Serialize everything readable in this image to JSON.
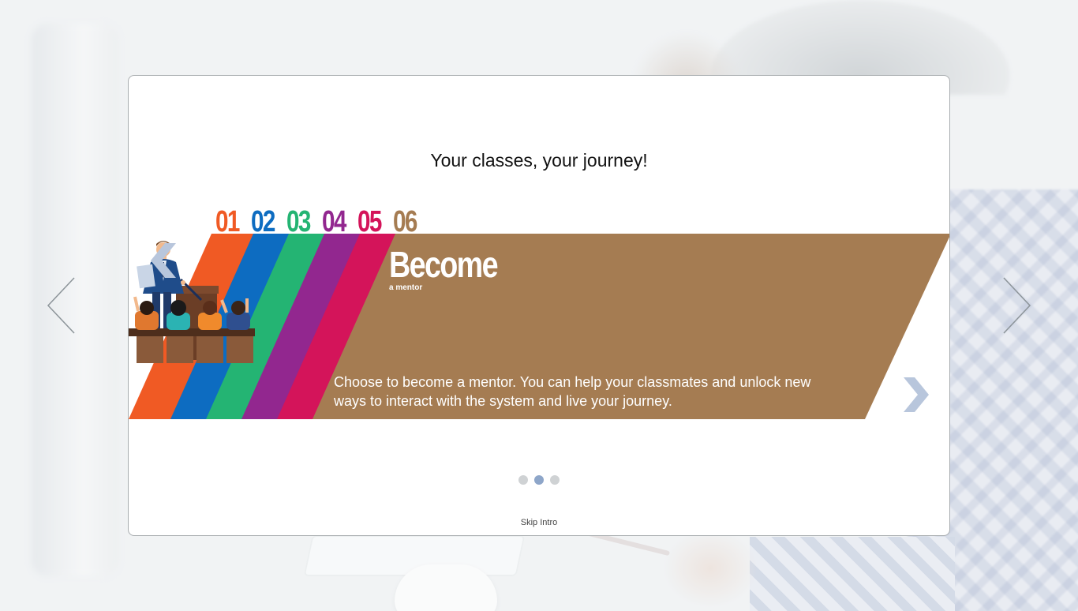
{
  "intro": {
    "title": "Your classes, your journey!",
    "step_numbers": [
      {
        "label": "01",
        "color": "#f05a24"
      },
      {
        "label": "02",
        "color": "#0d6cc1"
      },
      {
        "label": "03",
        "color": "#24b473"
      },
      {
        "label": "04",
        "color": "#92278f"
      },
      {
        "label": "05",
        "color": "#d4145a"
      },
      {
        "label": "06",
        "color": "#a57c52"
      }
    ],
    "slide": {
      "heading": "Become",
      "subheading": "a mentor",
      "description": "Choose to become a mentor. You can help your classmates and unlock new ways to interact with the system and live your journey.",
      "background_color": "#a57c52",
      "illustration_icon": "teacher-classroom-illustration"
    },
    "pagination": {
      "count": 3,
      "active_index": 1,
      "active_color": "#8ea6c9"
    },
    "skip_label": "Skip Intro",
    "icons": {
      "inner_prev": "chevron-left-icon",
      "inner_next": "chevron-right-icon",
      "outer_prev": "thin-chevron-left-icon",
      "outer_next": "thin-chevron-right-icon"
    }
  }
}
